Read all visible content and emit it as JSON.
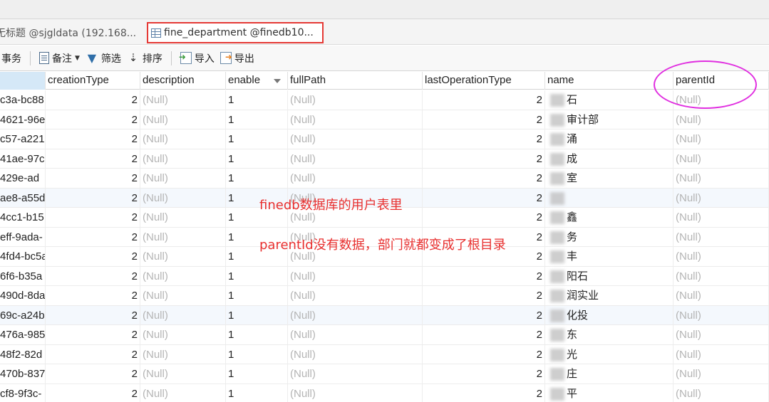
{
  "tabs": {
    "inactive_label": "无标题 @sjgldata (192.168....",
    "active_label": "fine_department @finedb10..."
  },
  "toolbar": {
    "transaction": "事务",
    "note": "备注",
    "filter": "筛选",
    "sort": "排序",
    "import": "导入",
    "export": "导出"
  },
  "columns": {
    "creationType": "creationType",
    "description": "description",
    "enable": "enable",
    "fullPath": "fullPath",
    "lastOperationType": "lastOperationType",
    "name": "name",
    "parentId": "parentId"
  },
  "null_text": "(Null)",
  "rows": [
    {
      "id": "c3a-bc88",
      "creationType": "2",
      "enable": "1",
      "lastOperationType": "2",
      "name": "石"
    },
    {
      "id": "4621-96e",
      "creationType": "2",
      "enable": "1",
      "lastOperationType": "2",
      "name": "审计部"
    },
    {
      "id": "c57-a221",
      "creationType": "2",
      "enable": "1",
      "lastOperationType": "2",
      "name": "涌"
    },
    {
      "id": "41ae-97c",
      "creationType": "2",
      "enable": "1",
      "lastOperationType": "2",
      "name": "成"
    },
    {
      "id": "429e-ad",
      "creationType": "2",
      "enable": "1",
      "lastOperationType": "2",
      "name": "室"
    },
    {
      "id": "ae8-a55d",
      "creationType": "2",
      "enable": "1",
      "lastOperationType": "2",
      "name": ""
    },
    {
      "id": "4cc1-b15",
      "creationType": "2",
      "enable": "1",
      "lastOperationType": "2",
      "name": "鑫"
    },
    {
      "id": "eff-9ada-",
      "creationType": "2",
      "enable": "1",
      "lastOperationType": "2",
      "name": "务"
    },
    {
      "id": "4fd4-bc5a",
      "creationType": "2",
      "enable": "1",
      "lastOperationType": "2",
      "name": "丰"
    },
    {
      "id": "6f6-b35a",
      "creationType": "2",
      "enable": "1",
      "lastOperationType": "2",
      "name": "阳石"
    },
    {
      "id": "490d-8da",
      "creationType": "2",
      "enable": "1",
      "lastOperationType": "2",
      "name": "润实业"
    },
    {
      "id": "69c-a24b-",
      "creationType": "2",
      "enable": "1",
      "lastOperationType": "2",
      "name": "化投"
    },
    {
      "id": "476a-985",
      "creationType": "2",
      "enable": "1",
      "lastOperationType": "2",
      "name": "东"
    },
    {
      "id": "48f2-82d",
      "creationType": "2",
      "enable": "1",
      "lastOperationType": "2",
      "name": "光"
    },
    {
      "id": "470b-837",
      "creationType": "2",
      "enable": "1",
      "lastOperationType": "2",
      "name": "庄"
    },
    {
      "id": "cf8-9f3c-",
      "creationType": "2",
      "enable": "1",
      "lastOperationType": "2",
      "name": "平"
    }
  ],
  "annotations": {
    "line1": "finedb数据库的用户表里",
    "line2": "parentId没有数据，部门就都变成了根目录"
  },
  "colors": {
    "annotation_red": "#e8302f",
    "highlight_magenta": "#e02fe0",
    "null_gray": "#b4b4b4"
  }
}
